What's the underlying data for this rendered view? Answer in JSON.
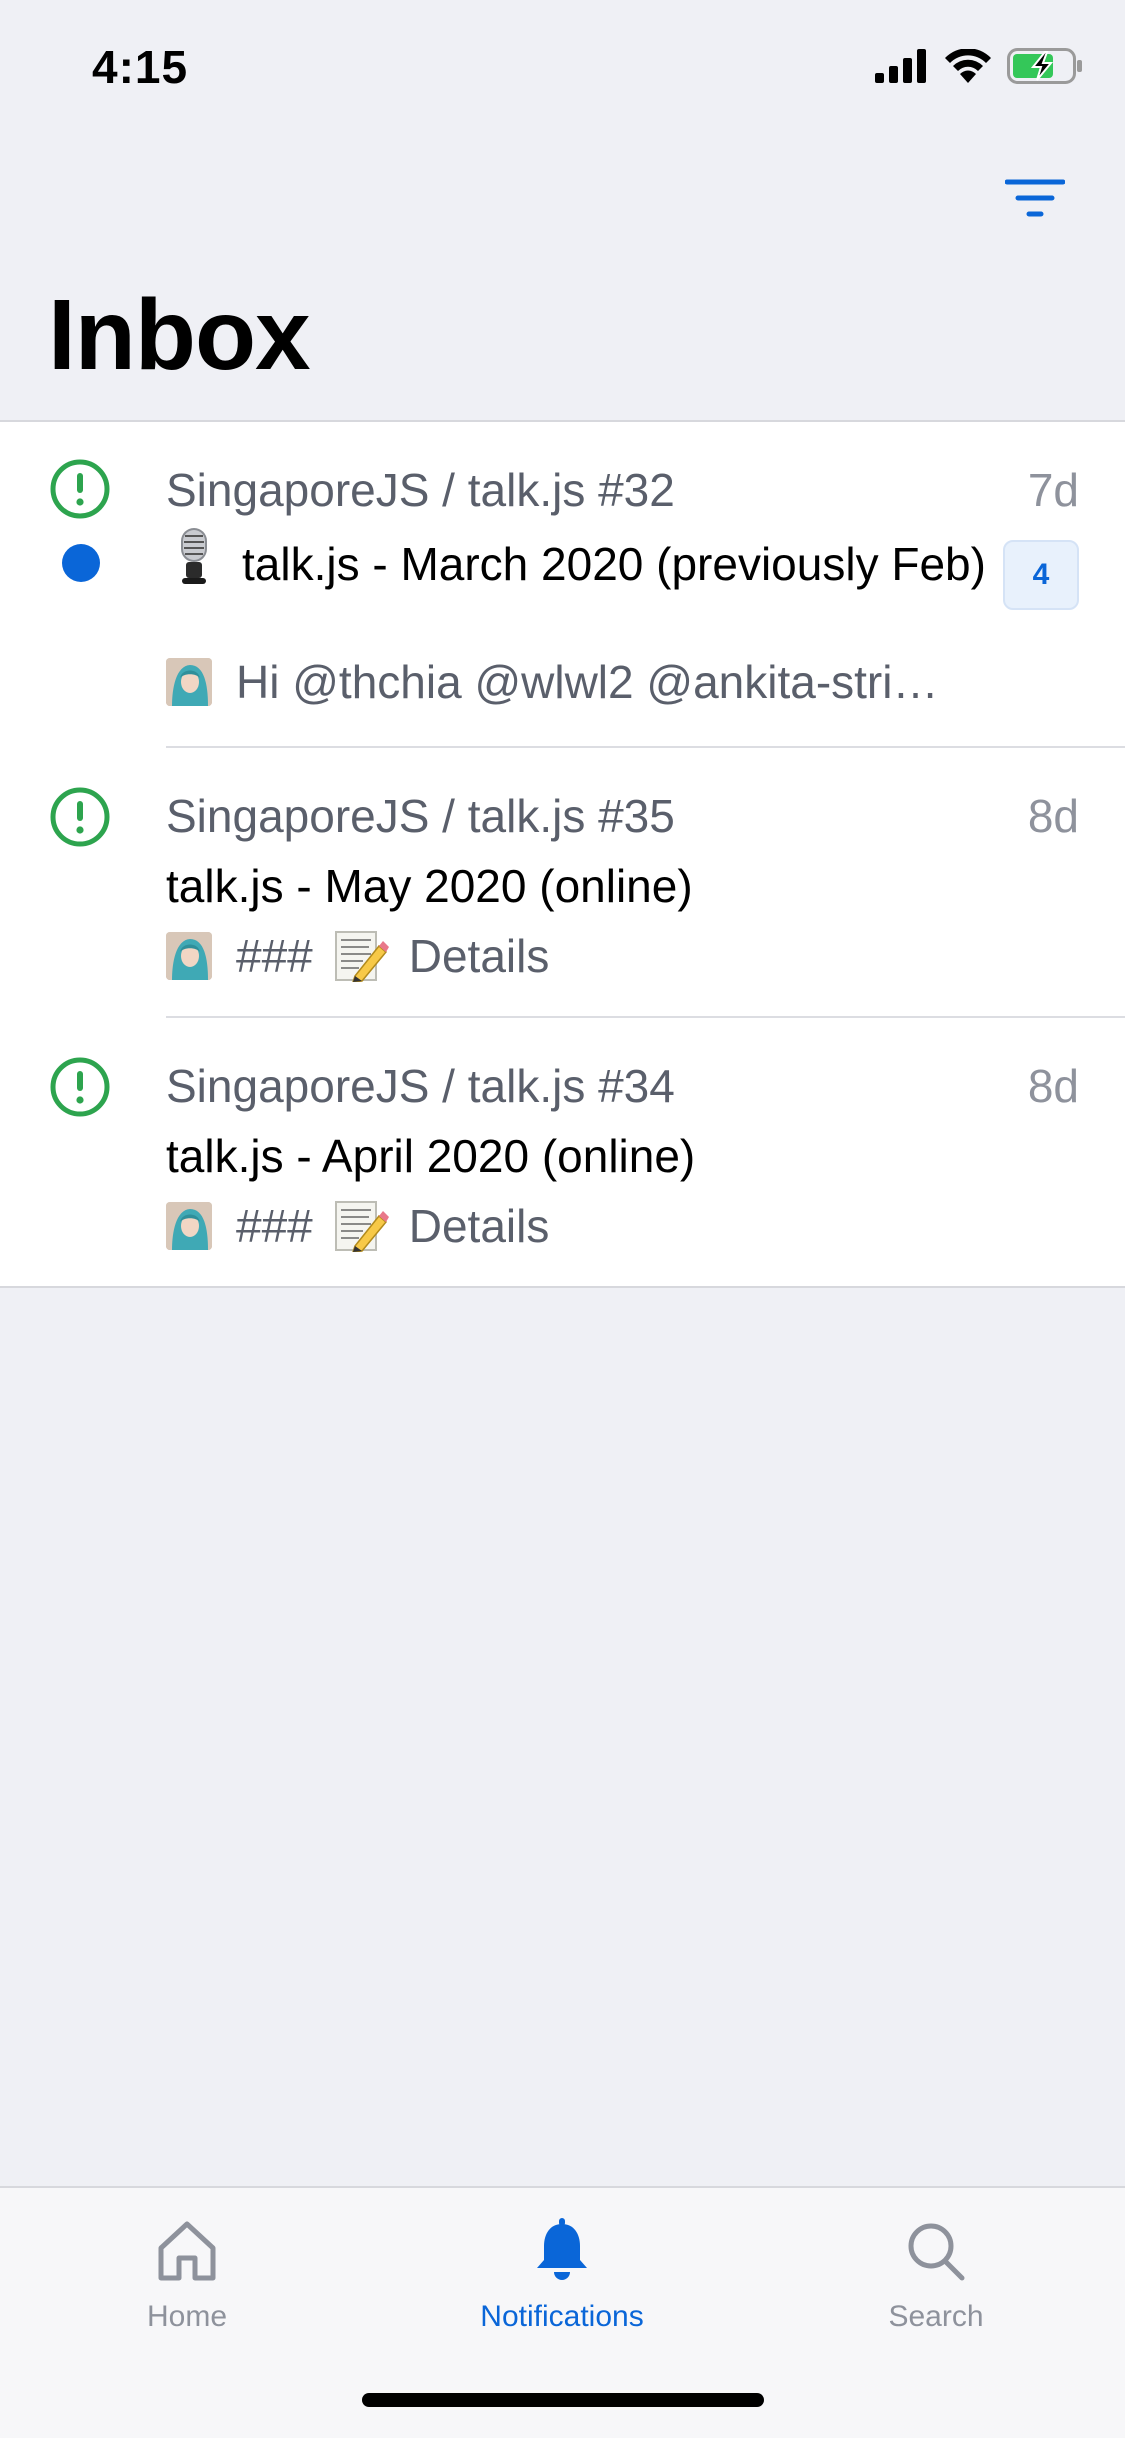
{
  "status_bar": {
    "time": "4:15",
    "icons": [
      "cellular-signal-icon",
      "wifi-icon",
      "battery-charging-icon"
    ]
  },
  "header": {
    "title": "Inbox",
    "filter_icon": "filter-icon"
  },
  "notifications": [
    {
      "repo": "SingaporeJS / talk.js #32",
      "time": "7d",
      "title": "talk.js - March 2020 (previously Feb)",
      "title_emoji": "microphone",
      "unread": true,
      "comment_count": "4",
      "preview": "Hi @thchia @wlwl2 @ankita-stri…",
      "icon": "issue-open-icon"
    },
    {
      "repo": "SingaporeJS / talk.js #35",
      "time": "8d",
      "title": "talk.js - May 2020 (online)",
      "preview_prefix": "###",
      "preview_emoji": "memo",
      "preview": "Details",
      "icon": "issue-open-icon"
    },
    {
      "repo": "SingaporeJS / talk.js #34",
      "time": "8d",
      "title": "talk.js - April 2020 (online)",
      "preview_prefix": "###",
      "preview_emoji": "memo",
      "preview": "Details",
      "icon": "issue-open-icon"
    }
  ],
  "tab_bar": {
    "tabs": [
      {
        "label": "Home",
        "icon": "home-icon",
        "active": false
      },
      {
        "label": "Notifications",
        "icon": "bell-icon",
        "active": true
      },
      {
        "label": "Search",
        "icon": "search-icon",
        "active": false
      }
    ]
  },
  "colors": {
    "accent": "#0a66d8",
    "issue_open": "#2da44e",
    "background": "#eff0f5",
    "secondary_text": "#5a5f6b"
  }
}
